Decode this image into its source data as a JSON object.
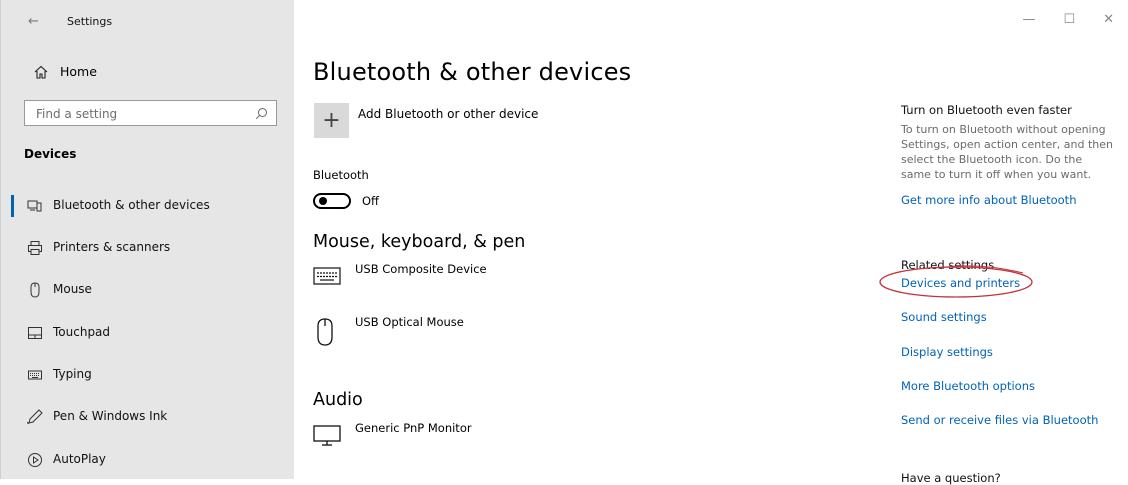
{
  "window": {
    "title": "Settings",
    "back": "←",
    "minimize": "—",
    "maximize": "☐",
    "close": "✕"
  },
  "sidebar": {
    "home_label": "Home",
    "search_placeholder": "Find a setting",
    "section_title": "Devices",
    "items": [
      {
        "label": "Bluetooth & other devices",
        "icon": "bluetooth-devices-icon",
        "active": true
      },
      {
        "label": "Printers & scanners",
        "icon": "printer-icon"
      },
      {
        "label": "Mouse",
        "icon": "mouse-icon"
      },
      {
        "label": "Touchpad",
        "icon": "touchpad-icon"
      },
      {
        "label": "Typing",
        "icon": "keyboard-icon"
      },
      {
        "label": "Pen & Windows Ink",
        "icon": "pen-icon"
      },
      {
        "label": "AutoPlay",
        "icon": "autoplay-icon"
      }
    ]
  },
  "main": {
    "title": "Bluetooth & other devices",
    "add_device_label": "Add Bluetooth or other device",
    "bluetooth_label": "Bluetooth",
    "bluetooth_state": "Off",
    "mouse_section_title": "Mouse, keyboard, & pen",
    "mouse_devices": [
      {
        "name": "USB Composite Device",
        "icon": "keyboard-icon"
      },
      {
        "name": "USB Optical Mouse",
        "icon": "mouse-icon"
      }
    ],
    "audio_section_title": "Audio",
    "audio_devices": [
      {
        "name": "Generic PnP Monitor",
        "icon": "monitor-icon"
      }
    ]
  },
  "right": {
    "tip_heading": "Turn on Bluetooth even faster",
    "tip_text": "To turn on Bluetooth without opening Settings, open action center, and then select the Bluetooth icon. Do the same to turn it off when you want.",
    "tip_link": "Get more info about Bluetooth",
    "related_heading": "Related settings",
    "related_links": [
      "Devices and printers",
      "Sound settings",
      "Display settings",
      "More Bluetooth options",
      "Send or receive files via Bluetooth"
    ],
    "question_heading": "Have a question?"
  },
  "colors": {
    "accent": "#0063b1",
    "link": "#0062b8",
    "sidebar_bg": "#e6e6e6",
    "annotation": "#c0343a"
  }
}
